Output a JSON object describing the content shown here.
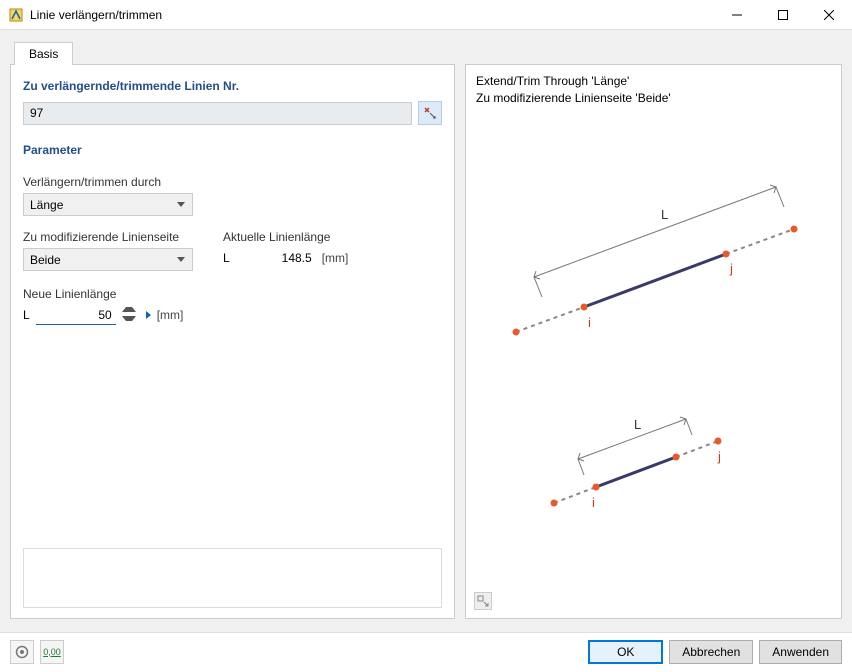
{
  "window": {
    "title": "Linie verlängern/trimmen"
  },
  "tabs": {
    "basis": "Basis"
  },
  "left": {
    "section_lines": "Zu verlängernde/trimmende Linien Nr.",
    "line_nr_value": "97",
    "section_params": "Parameter",
    "label_through": "Verlängern/trimmen durch",
    "through_value": "Länge",
    "label_side": "Zu modifizierende Linienseite",
    "side_value": "Beide",
    "label_current_len": "Aktuelle Linienlänge",
    "current_len_symbol": "L",
    "current_len_value": "148.5",
    "current_len_unit": "[mm]",
    "label_new_len": "Neue Linienlänge",
    "new_len_symbol": "L",
    "new_len_value": "50",
    "new_len_unit": "[mm]"
  },
  "right": {
    "line1": "Extend/Trim Through 'Länge'",
    "line2": "Zu modifizierende Linienseite 'Beide'",
    "label_L": "L",
    "label_i": "i",
    "label_j": "j"
  },
  "buttons": {
    "ok": "OK",
    "cancel": "Abbrechen",
    "apply": "Anwenden"
  },
  "toolbar_bottom": {
    "num_icon_text": "0,00"
  }
}
